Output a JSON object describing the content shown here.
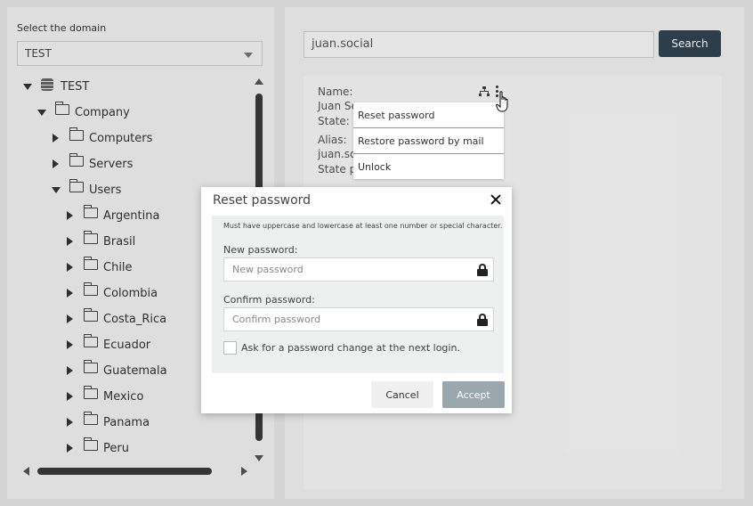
{
  "domain_selector": {
    "label": "Select the domain",
    "selected": "TEST"
  },
  "tree": {
    "root": "TEST",
    "company": "Company",
    "children": [
      "Computers",
      "Servers",
      "Users"
    ],
    "users_children": [
      "Argentina",
      "Brasil",
      "Chile",
      "Colombia",
      "Costa_Rica",
      "Ecuador",
      "Guatemala",
      "Mexico",
      "Panama",
      "Peru"
    ]
  },
  "search": {
    "value": "juan.social",
    "button_label": "Search"
  },
  "user_card": {
    "name_label": "Name:",
    "name_value": "Juan Se",
    "state_label": "State:",
    "alias_label": "Alias:",
    "alias_value": "juan.so",
    "state_p_label": "State p"
  },
  "context_menu": {
    "items": [
      "Reset password",
      "Restore password by mail",
      "Unlock"
    ]
  },
  "modal": {
    "title": "Reset password",
    "hint": "Must have uppercase and lowercase at least one number or special character.",
    "new_password_label": "New password:",
    "new_password_placeholder": "New password",
    "confirm_password_label": "Confirm password:",
    "confirm_password_placeholder": "Confirm password",
    "checkbox_label": "Ask for a password change at the next login.",
    "cancel_label": "Cancel",
    "accept_label": "Accept"
  },
  "colors": {
    "primary_button": "#2f4450",
    "accept_disabled": "#98a8ae"
  }
}
